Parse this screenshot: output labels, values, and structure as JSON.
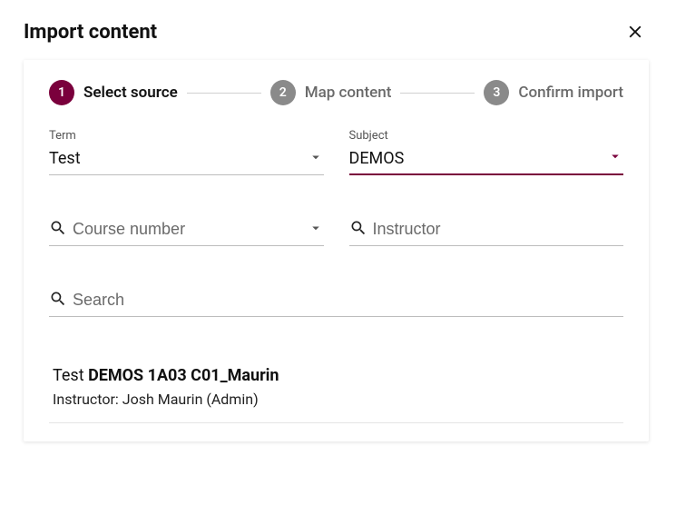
{
  "header": {
    "title": "Import content"
  },
  "stepper": {
    "steps": [
      {
        "num": "1",
        "label": "Select source",
        "state": "active"
      },
      {
        "num": "2",
        "label": "Map content",
        "state": "inactive"
      },
      {
        "num": "3",
        "label": "Confirm import",
        "state": "inactive"
      }
    ]
  },
  "filters": {
    "term": {
      "label": "Term",
      "value": "Test",
      "active": false
    },
    "subject": {
      "label": "Subject",
      "value": "DEMOS",
      "active": true
    },
    "course": {
      "placeholder": "Course number"
    },
    "instructor": {
      "placeholder": "Instructor"
    },
    "search": {
      "placeholder": "Search"
    }
  },
  "results": [
    {
      "term": "Test",
      "code": "DEMOS 1A03 C01_Maurin",
      "instructor_line": "Instructor: Josh Maurin (Admin)"
    }
  ],
  "colors": {
    "accent": "#7a003c"
  }
}
